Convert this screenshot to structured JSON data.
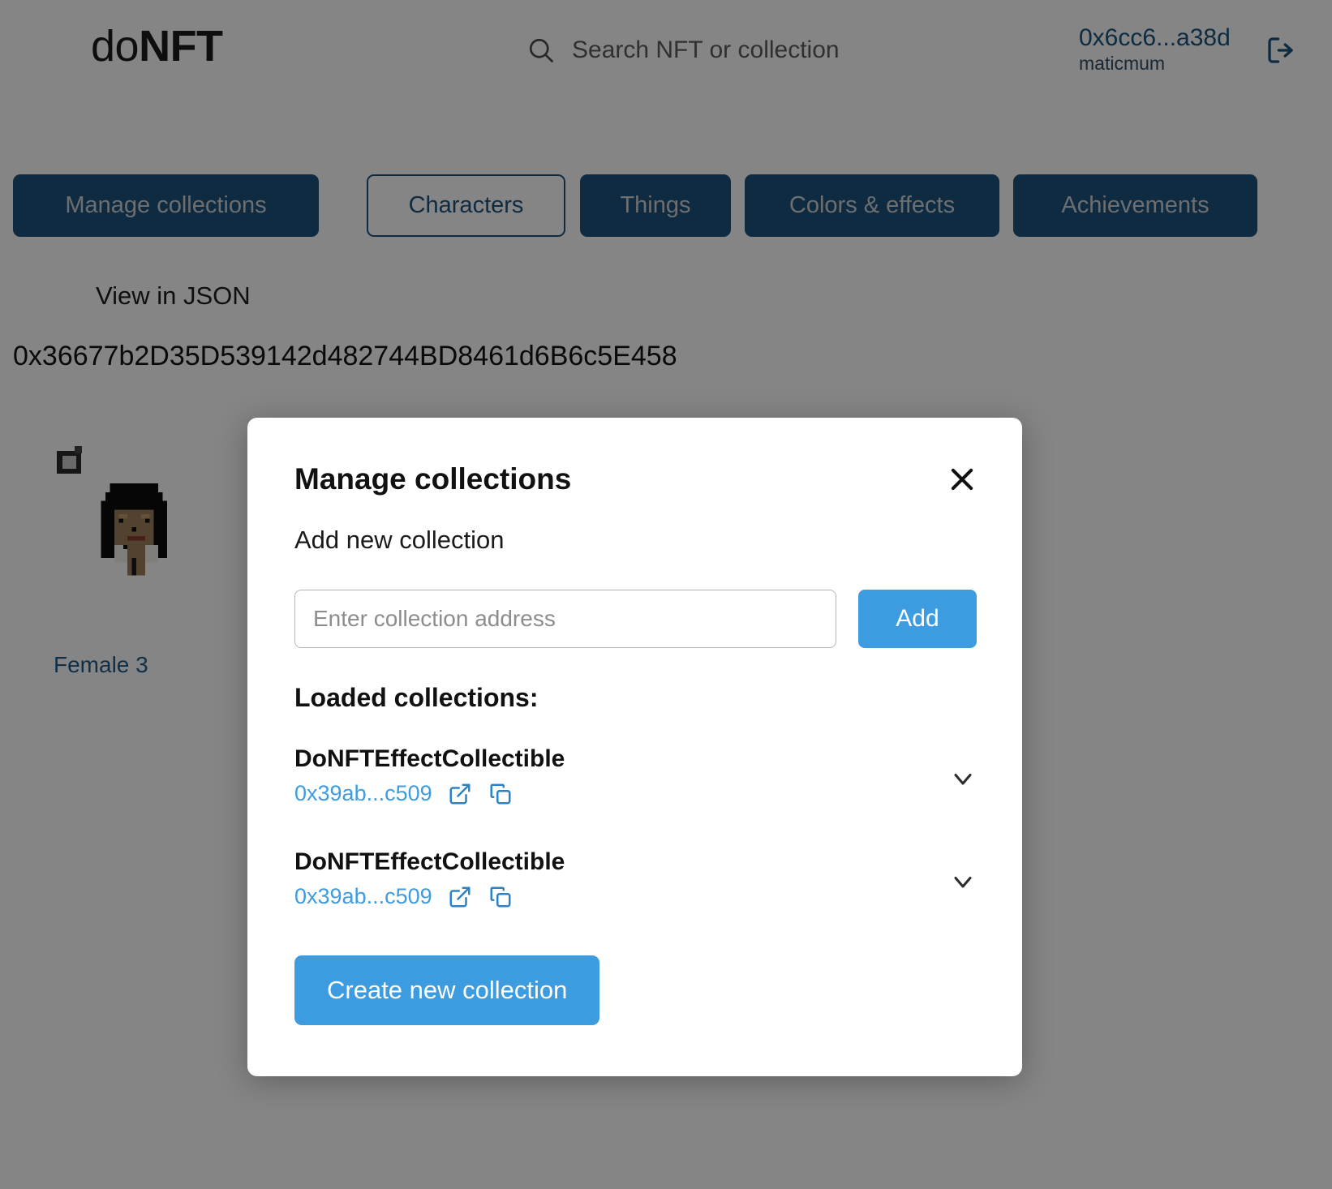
{
  "header": {
    "logo_prefix": "do",
    "logo_suffix": "NFT",
    "search_placeholder": "Search NFT or collection",
    "search_icon": "search-icon",
    "wallet_address": "0x6cc6...a38d",
    "wallet_network": "maticmum",
    "logout_icon": "logout-icon"
  },
  "nav": {
    "tabs": [
      {
        "label": "Manage collections",
        "style": "solid"
      },
      {
        "label": "Characters",
        "style": "outline"
      },
      {
        "label": "Things",
        "style": "solid"
      },
      {
        "label": "Colors & effects",
        "style": "solid"
      },
      {
        "label": "Achievements",
        "style": "solid"
      }
    ]
  },
  "toolbar": {
    "json_toggle_label": "View in JSON",
    "json_toggle_state": "off"
  },
  "content": {
    "contract_address": "0x36677b2D35D539142d482744BD8461d6B6c5E458",
    "nft_cards": [
      {
        "title": "Female 3",
        "broken_image_icon": "broken-image-icon"
      }
    ]
  },
  "modal": {
    "title": "Manage collections",
    "close_icon": "close-icon",
    "add_section_label": "Add new collection",
    "address_input_placeholder": "Enter collection address",
    "address_input_value": "",
    "add_button_label": "Add",
    "loaded_label": "Loaded collections:",
    "collections": [
      {
        "name": "DoNFTEffectCollectible",
        "address": "0x39ab...c509",
        "external_link_icon": "external-link-icon",
        "copy_icon": "copy-icon",
        "expand_icon": "chevron-down-icon"
      },
      {
        "name": "DoNFTEffectCollectible",
        "address": "0x39ab...c509",
        "external_link_icon": "external-link-icon",
        "copy_icon": "copy-icon",
        "expand_icon": "chevron-down-icon"
      }
    ],
    "create_button_label": "Create new collection"
  },
  "colors": {
    "accent_blue": "#3d9ce0",
    "nav_blue": "#1b5480",
    "link_blue": "#17547f",
    "modal_bg": "#ffffff"
  }
}
